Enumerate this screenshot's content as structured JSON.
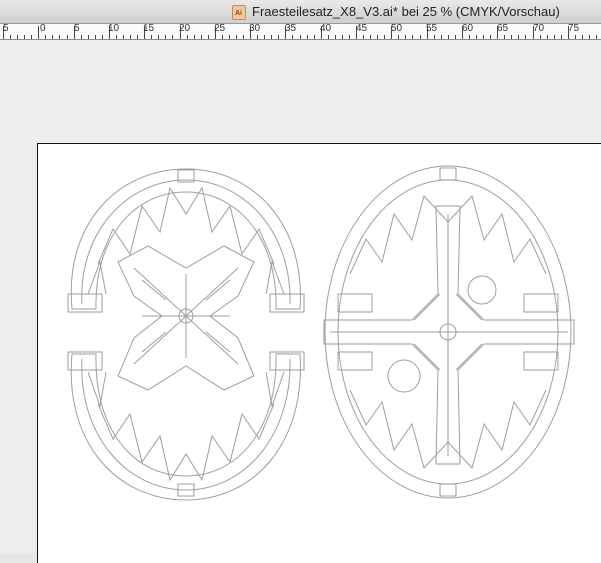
{
  "window": {
    "title": "Fraesteilesatz_X8_V3.ai* bei 25 % (CMYK/Vorschau)",
    "icon": "illustrator-doc-icon",
    "icon_text": "Ai"
  },
  "ruler": {
    "labels": [
      "5",
      "0",
      "5",
      "10",
      "15",
      "20",
      "25",
      "30",
      "35",
      "40",
      "45",
      "50",
      "55",
      "60",
      "65",
      "70",
      "75"
    ]
  },
  "colors": {
    "canvas": "#ededed",
    "artboard": "#ffffff",
    "artwork_stroke": "#9e9e9e"
  }
}
